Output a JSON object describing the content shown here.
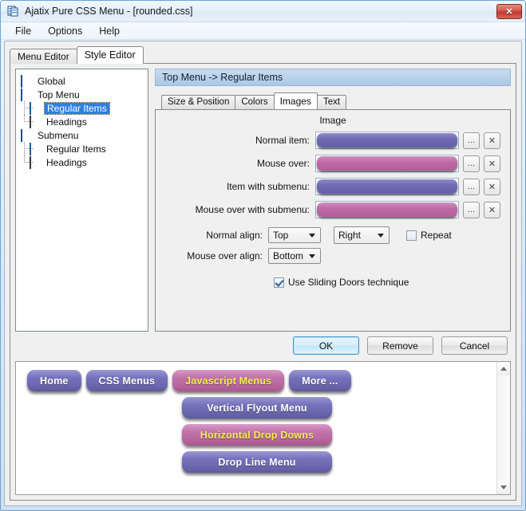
{
  "window": {
    "title": "Ajatix Pure CSS Menu - [rounded.css]",
    "app_icon": "app-stack-icon",
    "close_label": "✕"
  },
  "menubar": {
    "items": [
      {
        "label": "File"
      },
      {
        "label": "Options"
      },
      {
        "label": "Help"
      }
    ]
  },
  "main_tabs": [
    {
      "label": "Menu Editor",
      "active": false
    },
    {
      "label": "Style Editor",
      "active": true
    }
  ],
  "tree": {
    "nodes": [
      {
        "label": "Global",
        "icon": "stack-icon",
        "level": 0,
        "selected": false
      },
      {
        "label": "Top Menu",
        "icon": "list-icon",
        "level": 0,
        "selected": false
      },
      {
        "label": "Regular Items",
        "icon": "blue-bar-icon",
        "level": 1,
        "selected": true
      },
      {
        "label": "Headings",
        "icon": "gray-bar-icon",
        "level": 1,
        "selected": false
      },
      {
        "label": "Submenu",
        "icon": "submenu-icon",
        "level": 0,
        "selected": false
      },
      {
        "label": "Regular Items",
        "icon": "blue-bar-icon",
        "level": 1,
        "selected": false
      },
      {
        "label": "Headings",
        "icon": "gray-bar-icon",
        "level": 1,
        "selected": false
      }
    ]
  },
  "settings": {
    "header": "Top Menu -> Regular Items",
    "tabs": [
      {
        "label": "Size & Position",
        "active": false
      },
      {
        "label": "Colors",
        "active": false
      },
      {
        "label": "Images",
        "active": true
      },
      {
        "label": "Text",
        "active": false
      }
    ],
    "group_title": "Image",
    "image_rows": [
      {
        "label": "Normal item:",
        "swatch": "purple",
        "browse": "...",
        "clear": "✕"
      },
      {
        "label": "Mouse over:",
        "swatch": "pink",
        "browse": "...",
        "clear": "✕"
      },
      {
        "label": "Item with submenu:",
        "swatch": "purple",
        "browse": "...",
        "clear": "✕"
      },
      {
        "label": "Mouse over with submenu:",
        "swatch": "pink",
        "browse": "...",
        "clear": "✕"
      }
    ],
    "normal_align": {
      "label": "Normal align:",
      "value": "Top"
    },
    "mouse_over_align": {
      "label": "Mouse over align:",
      "value": "Bottom"
    },
    "side_align": {
      "value": "Right"
    },
    "repeat": {
      "label": "Repeat",
      "checked": false
    },
    "sliding_doors": {
      "label": "Use Sliding Doors technique",
      "checked": true
    }
  },
  "buttons": {
    "ok": "OK",
    "remove": "Remove",
    "cancel": "Cancel"
  },
  "preview": {
    "rows": [
      {
        "indent": false,
        "items": [
          {
            "label": "Home",
            "style": "purple",
            "wide": false
          },
          {
            "label": "CSS Menus",
            "style": "purple",
            "wide": false
          },
          {
            "label": "Javascript Menus",
            "style": "pink",
            "wide": false
          },
          {
            "label": "More ...",
            "style": "purple",
            "wide": false
          }
        ]
      },
      {
        "indent": true,
        "items": [
          {
            "label": "Vertical Flyout Menu",
            "style": "purple",
            "wide": true
          }
        ]
      },
      {
        "indent": true,
        "items": [
          {
            "label": "Horizontal Drop Downs",
            "style": "pink",
            "wide": true
          }
        ]
      },
      {
        "indent": true,
        "items": [
          {
            "label": "Drop Line Menu",
            "style": "purple",
            "wide": true
          }
        ]
      }
    ],
    "scroll_up": "▲",
    "scroll_down": "▼"
  },
  "colors": {
    "accent_purple": "#6f6cb4",
    "accent_pink": "#bf6ca6",
    "highlight_text": "#f2f24e",
    "selection_blue": "#2f7fe0",
    "header_blue": "#aac8e4",
    "close_red": "#bc3b30"
  }
}
